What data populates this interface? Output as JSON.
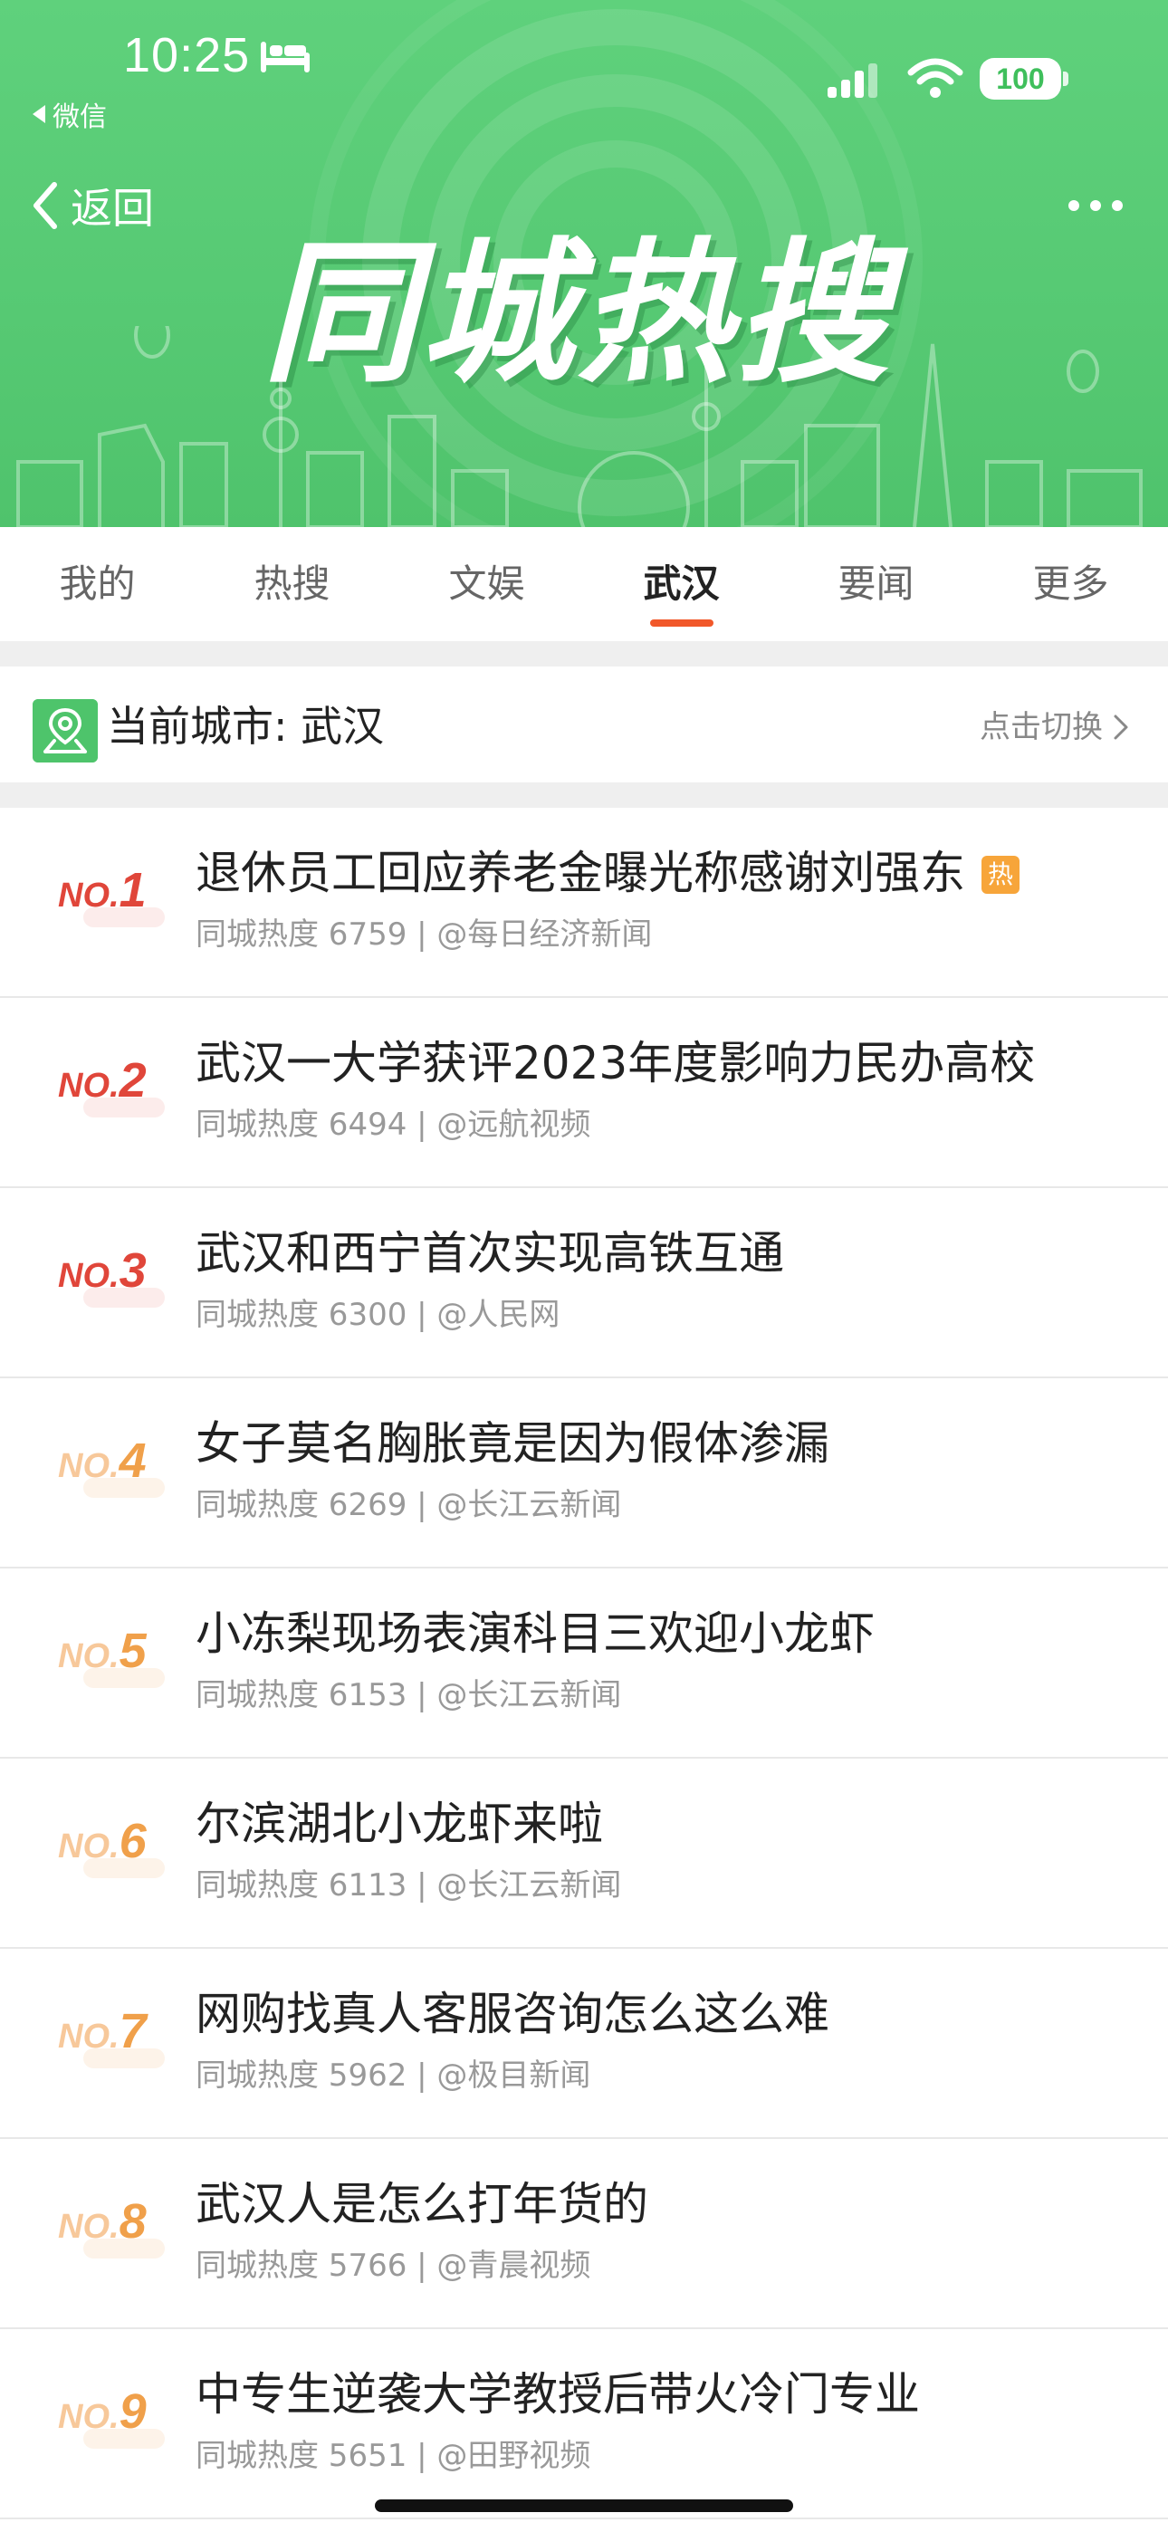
{
  "status_bar": {
    "time": "10:25",
    "back_app": "微信",
    "battery": "100"
  },
  "nav": {
    "back_label": "返回"
  },
  "banner": {
    "title": "同城热搜"
  },
  "tabs": [
    {
      "label": "我的",
      "active": false
    },
    {
      "label": "热搜",
      "active": false
    },
    {
      "label": "文娱",
      "active": false
    },
    {
      "label": "武汉",
      "active": true
    },
    {
      "label": "要闻",
      "active": false
    },
    {
      "label": "更多",
      "active": false
    }
  ],
  "city": {
    "label": "当前城市: 武汉",
    "switch_label": "点击切换"
  },
  "hot_list": [
    {
      "rank_prefix": "NO.",
      "rank": "1",
      "title": "退休员工回应养老金曝光称感谢刘强东",
      "badge": "热",
      "meta": "同城热度 6759 | @每日经济新闻",
      "color": "#e0463a"
    },
    {
      "rank_prefix": "NO.",
      "rank": "2",
      "title": "武汉一大学获评2023年度影响力民办高校",
      "badge": "",
      "meta": "同城热度 6494 | @远航视频",
      "color": "#e0463a"
    },
    {
      "rank_prefix": "NO.",
      "rank": "3",
      "title": "武汉和西宁首次实现高铁互通",
      "badge": "",
      "meta": "同城热度 6300 | @人民网",
      "color": "#e0463a"
    },
    {
      "rank_prefix": "NO.",
      "rank": "4",
      "title": "女子莫名胸胀竟是因为假体渗漏",
      "badge": "",
      "meta": "同城热度 6269 | @长江云新闻",
      "color": "#f0a04a"
    },
    {
      "rank_prefix": "NO.",
      "rank": "5",
      "title": "小冻梨现场表演科目三欢迎小龙虾",
      "badge": "",
      "meta": "同城热度 6153 | @长江云新闻",
      "color": "#f0a04a"
    },
    {
      "rank_prefix": "NO.",
      "rank": "6",
      "title": "尔滨湖北小龙虾来啦",
      "badge": "",
      "meta": "同城热度 6113 | @长江云新闻",
      "color": "#f0a04a"
    },
    {
      "rank_prefix": "NO.",
      "rank": "7",
      "title": "网购找真人客服咨询怎么这么难",
      "badge": "",
      "meta": "同城热度 5962 | @极目新闻",
      "color": "#f0a04a"
    },
    {
      "rank_prefix": "NO.",
      "rank": "8",
      "title": "武汉人是怎么打年货的",
      "badge": "",
      "meta": "同城热度 5766 | @青晨视频",
      "color": "#f0a04a"
    },
    {
      "rank_prefix": "NO.",
      "rank": "9",
      "title": "中专生逆袭大学教授后带火冷门专业",
      "badge": "",
      "meta": "同城热度 5651 | @田野视频",
      "color": "#f0a04a"
    }
  ],
  "colors": {
    "banner_green": "#56c973",
    "tab_indicator": "#f1582a",
    "top3_rank": "#e0463a",
    "rank_other": "#f0a04a",
    "hot_badge": "#f7a53a"
  }
}
